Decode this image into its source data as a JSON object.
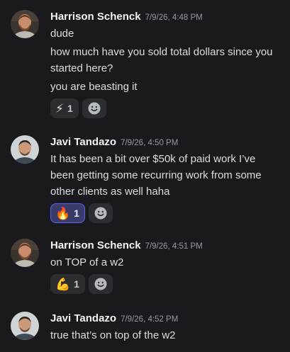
{
  "messages": [
    {
      "author": "Harrison Schenck",
      "timestamp": "7/9/26, 4:48 PM",
      "avatar": "avatar-harrison",
      "lines": [
        "dude",
        "how much have you sold total dollars since you started here?",
        "you are beasting it"
      ],
      "reaction": {
        "emoji": "⚡",
        "count": "1",
        "icon": "lightning-emoji"
      }
    },
    {
      "author": "Javi Tandazo",
      "timestamp": "7/9/26, 4:50 PM",
      "avatar": "avatar-javi",
      "lines": [
        "It has been a bit over $50k of paid work I’ve been getting some recurring work from some other clients as well haha"
      ],
      "reaction": {
        "emoji": "🔥",
        "count": "1",
        "icon": "fire-emoji"
      }
    },
    {
      "author": "Harrison Schenck",
      "timestamp": "7/9/26, 4:51 PM",
      "avatar": "avatar-harrison",
      "lines": [
        "on TOP of a w2"
      ],
      "reaction": {
        "emoji": "💪",
        "count": "1",
        "icon": "flexed-biceps-emoji"
      }
    },
    {
      "author": "Javi Tandazo",
      "timestamp": "7/9/26, 4:52 PM",
      "avatar": "avatar-javi",
      "lines": [
        "true that’s on top of the w2"
      ]
    }
  ],
  "icons": {
    "add_reaction": "smiley-add-reaction-icon"
  },
  "colors": {
    "background": "#1a1a1e",
    "selected_reaction_border": "#5865f2",
    "selected_reaction_bg": "#3a3b6b"
  }
}
